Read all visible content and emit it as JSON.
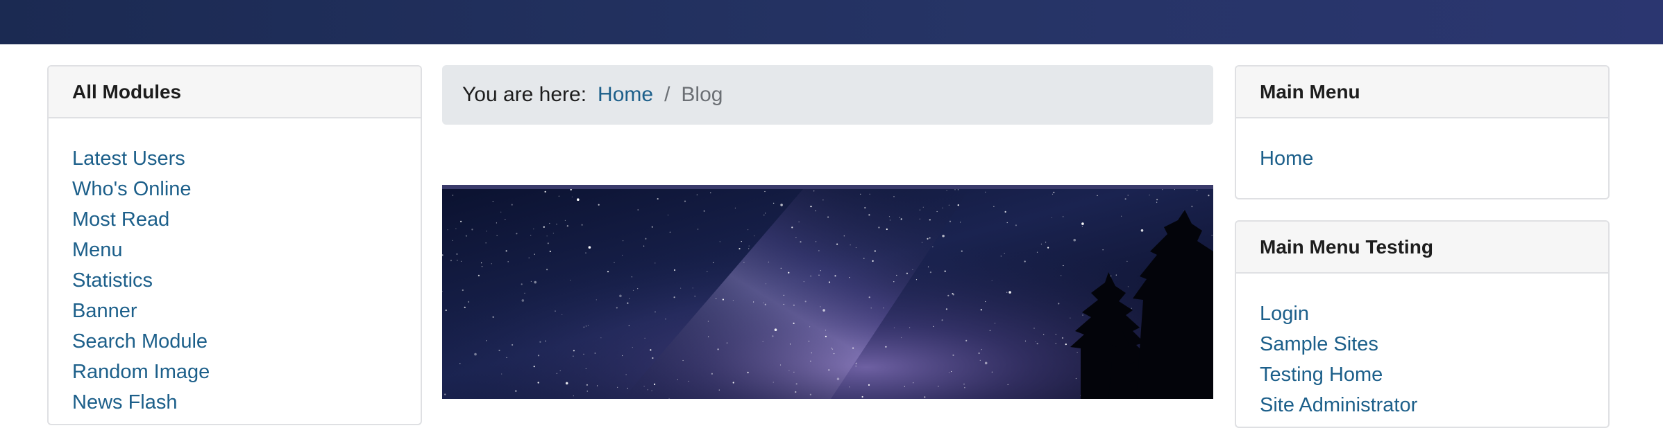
{
  "left_panel": {
    "title": "All Modules",
    "items": [
      {
        "label": "Latest Users"
      },
      {
        "label": "Who's Online"
      },
      {
        "label": "Most Read"
      },
      {
        "label": "Menu"
      },
      {
        "label": "Statistics"
      },
      {
        "label": "Banner"
      },
      {
        "label": "Search Module"
      },
      {
        "label": "Random Image"
      },
      {
        "label": "News Flash"
      }
    ]
  },
  "breadcrumb": {
    "prefix": "You are here:",
    "home": "Home",
    "separator": "/",
    "current": "Blog"
  },
  "hero_image": {
    "subject": "starry-night-milky-way-with-trees"
  },
  "right_panel_main": {
    "title": "Main Menu",
    "items": [
      {
        "label": "Home"
      }
    ]
  },
  "right_panel_testing": {
    "title": "Main Menu Testing",
    "items": [
      {
        "label": "Login"
      },
      {
        "label": "Sample Sites"
      },
      {
        "label": "Testing Home"
      },
      {
        "label": "Site Administrator"
      }
    ]
  },
  "colors": {
    "topbar": "#263466",
    "link": "#1c5f8a",
    "breadcrumb_bg": "#e5e8eb"
  }
}
